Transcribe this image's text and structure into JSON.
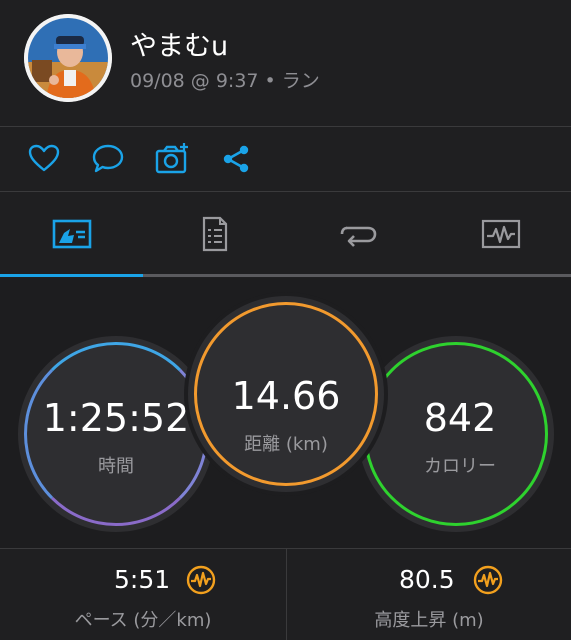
{
  "header": {
    "username": "やまむu",
    "meta": "09/08 @ 9:37 • ラン"
  },
  "actions": [
    {
      "icon": "heart-icon"
    },
    {
      "icon": "comment-icon"
    },
    {
      "icon": "add-photo-icon"
    },
    {
      "icon": "share-icon"
    }
  ],
  "tabs": [
    {
      "icon": "overview-icon",
      "active": true
    },
    {
      "icon": "details-icon",
      "active": false
    },
    {
      "icon": "laps-icon",
      "active": false
    },
    {
      "icon": "charts-icon",
      "active": false
    }
  ],
  "stats": {
    "time": {
      "value": "1:25:52",
      "label": "時間"
    },
    "distance": {
      "value": "14.66",
      "label": "距離 (km)"
    },
    "calories": {
      "value": "842",
      "label": "カロリー"
    }
  },
  "metrics": {
    "pace": {
      "value": "5:51",
      "label": "ペース (分／km)",
      "badge": "performance-icon"
    },
    "elevation": {
      "value": "80.5",
      "label": "高度上昇 (m)",
      "badge": "performance-icon"
    }
  },
  "colors": {
    "accent": "#1aa3e8",
    "distance_ring": "#f29a2e",
    "calories_ring": "#2ed22e",
    "time_ring_top": "#3fa6e6",
    "time_ring_bottom": "#8a6bc9",
    "badge": "#f2a01e"
  }
}
